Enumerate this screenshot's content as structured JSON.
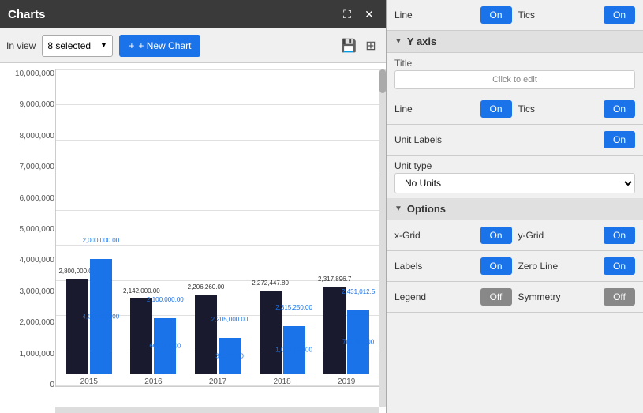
{
  "titleBar": {
    "title": "Charts",
    "expandIcon": "⛶",
    "closeIcon": "✕"
  },
  "toolbar": {
    "inViewLabel": "In view",
    "selectedCount": "8 selected",
    "newChartLabel": "+ New Chart",
    "saveIcon": "💾",
    "printIcon": "🖨"
  },
  "chart": {
    "yAxisLabels": [
      "10,000,000",
      "9,000,000",
      "8,000,000",
      "7,000,000",
      "6,000,000",
      "5,000,000",
      "4,000,000",
      "3,000,000",
      "2,000,000",
      "1,000,000",
      "0"
    ],
    "bars": [
      {
        "year": "2015",
        "darkHeight": 120,
        "blueHeight": 145,
        "darkLabel": "2,800,000.00",
        "blueTopLabel": "2,000,000.00",
        "blueBotLabel": "4,000,000.00"
      },
      {
        "year": "2016",
        "darkHeight": 95,
        "blueHeight": 70,
        "darkLabel": "2,142,000.00",
        "blueTopLabel": "2,100,000.00",
        "blueBotLabel": "600,000.00"
      },
      {
        "year": "2017",
        "darkHeight": 100,
        "blueHeight": 45,
        "darkLabel": "2,206,260.00",
        "blueTopLabel": "2,205,000.00",
        "blueBotLabel": "30,000.00"
      },
      {
        "year": "2018",
        "darkHeight": 105,
        "blueHeight": 60,
        "darkLabel": "2,272,447.80",
        "blueTopLabel": "2,315,250.00",
        "blueBotLabel": "1,000,000.00"
      },
      {
        "year": "2019",
        "darkHeight": 110,
        "blueHeight": 80,
        "darkLabel": "2,317,896.7",
        "blueTopLabel": "2,431,012.5",
        "blueBotLabel": "700,000.00"
      }
    ]
  },
  "rightPanel": {
    "xAxisSection": {
      "lineLabel": "Line",
      "lineState": "On",
      "ticsLabel": "Tics",
      "ticsState": "On"
    },
    "yAxisHeader": "Y axis",
    "titleLabel": "Title",
    "clickToEdit": "Click to edit",
    "yAxisLine": {
      "lineLabel": "Line",
      "lineState": "On",
      "ticsLabel": "Tics",
      "ticsState": "On"
    },
    "unitLabels": {
      "label": "Unit Labels",
      "state": "On"
    },
    "unitType": {
      "label": "Unit type",
      "value": "No Units"
    },
    "optionsHeader": "Options",
    "xGrid": {
      "label": "x-Grid",
      "state": "On"
    },
    "yGrid": {
      "label": "y-Grid",
      "state": "On"
    },
    "labels": {
      "label": "Labels",
      "state": "On"
    },
    "zeroLine": {
      "label": "Zero Line",
      "state": "On"
    },
    "legend": {
      "label": "Legend",
      "state": "Off"
    },
    "symmetry": {
      "label": "Symmetry",
      "state": "Off"
    }
  }
}
